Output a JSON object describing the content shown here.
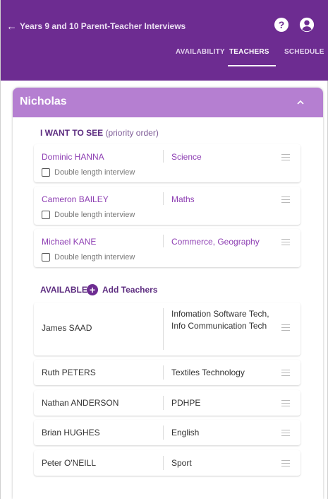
{
  "header": {
    "back_icon": "arrow-left-icon",
    "title": "Years 9 and 10 Parent-Teacher Interviews",
    "help_icon": "?",
    "account_icon": "account-circle-icon"
  },
  "tabs": [
    {
      "label": "AVAILABILITY",
      "active": false
    },
    {
      "label": "TEACHERS",
      "active": true
    },
    {
      "label": "SCHEDULE",
      "active": false
    }
  ],
  "student": {
    "name": "Nicholas",
    "collapse_icon": "chevron-up-icon"
  },
  "want_to_see": {
    "label": "I WANT TO SEE",
    "sub_label": "(priority order)",
    "double_length_label": "Double length interview",
    "teachers": [
      {
        "name": "Dominic HANNA",
        "subject": "Science",
        "double_length": false
      },
      {
        "name": "Cameron BAILEY",
        "subject": "Maths",
        "double_length": false
      },
      {
        "name": "Michael KANE",
        "subject": "Commerce, Geography",
        "double_length": false
      }
    ]
  },
  "available": {
    "label": "AVAILABLE",
    "add_label": "Add Teachers",
    "teachers": [
      {
        "name": "James SAAD",
        "subject": "Infomation Software Tech, Info Communication Tech"
      },
      {
        "name": "Ruth PETERS",
        "subject": "Textiles Technology"
      },
      {
        "name": "Nathan ANDERSON",
        "subject": "PDHPE"
      },
      {
        "name": "Brian HUGHES",
        "subject": "English"
      },
      {
        "name": "Peter O'NEILL",
        "subject": "Sport"
      }
    ]
  },
  "colors": {
    "brand": "#6d2c91",
    "card_header": "#b57fd1",
    "link_text": "#8e3fb3"
  }
}
